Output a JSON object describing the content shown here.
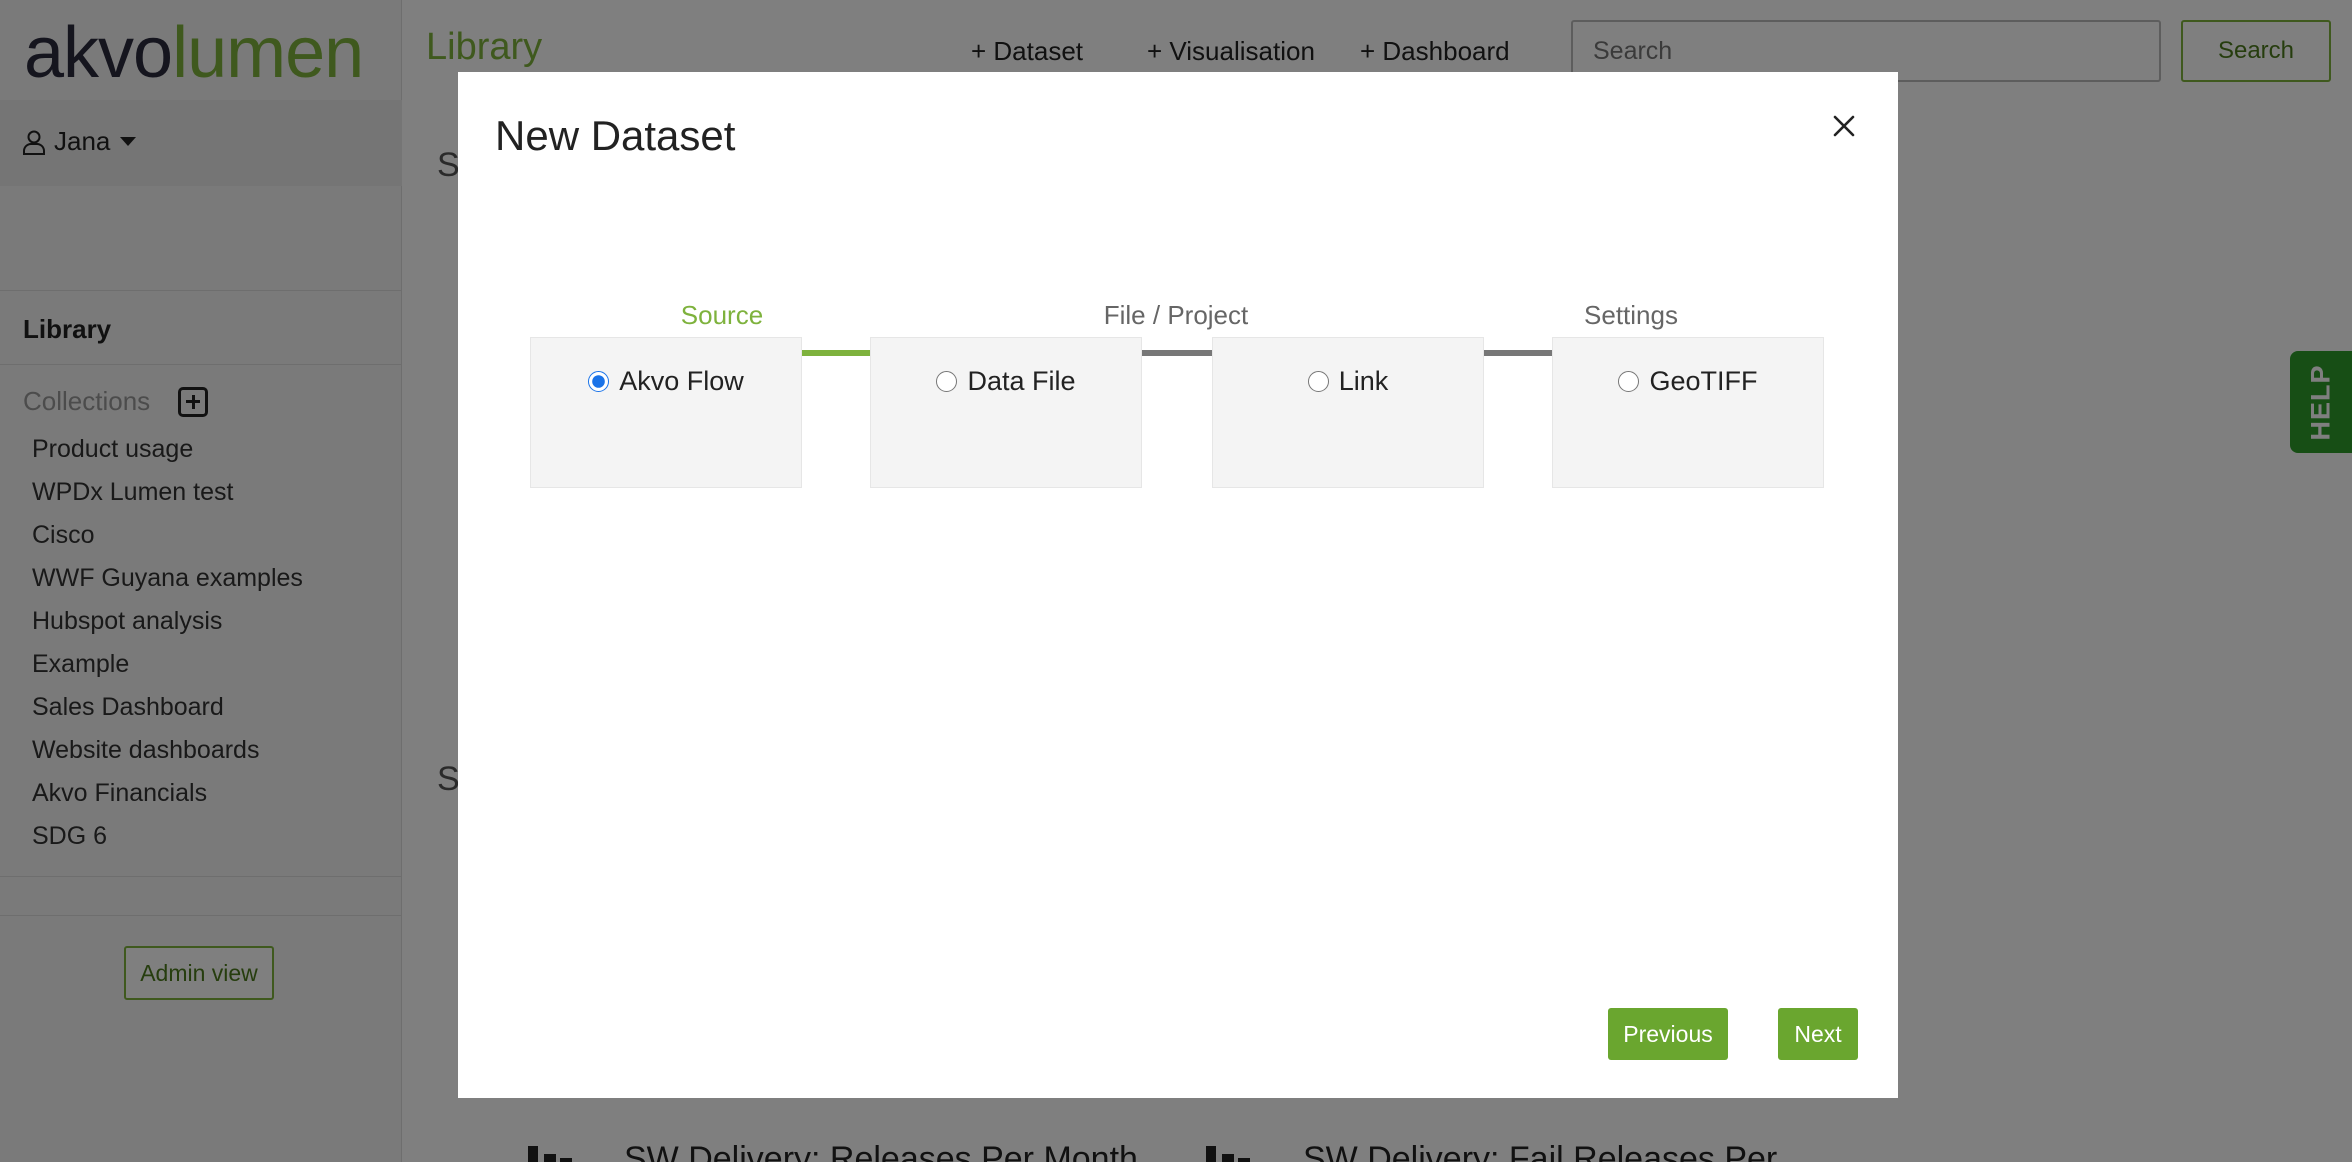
{
  "brand": {
    "logo_part1": "akvo",
    "logo_part2": "lumen"
  },
  "user": {
    "name": "Jana"
  },
  "sidebar": {
    "library_label": "Library",
    "collections_label": "Collections",
    "collections": [
      "Product usage",
      "WPDx Lumen test",
      "Cisco",
      "WWF Guyana examples",
      "Hubspot analysis",
      "Example",
      "Sales Dashboard",
      "Website dashboards",
      "Akvo Financials",
      "SDG 6"
    ],
    "admin_view": "Admin view"
  },
  "header": {
    "title": "Library",
    "create_dataset": "+ Dataset",
    "create_visualisation": "+ Visualisation",
    "create_dashboard": "+ Dashboard",
    "search_placeholder": "Search",
    "search_button": "Search"
  },
  "background": {
    "section_letter_1": "S",
    "section_letter_2": "S",
    "card_1": "SW Delivery: Releases Per Month",
    "card_2": "SW Delivery: Fail Releases Per"
  },
  "help": {
    "label": "HELP"
  },
  "modal": {
    "title": "New Dataset",
    "tabs": [
      {
        "label": "Source",
        "active": true
      },
      {
        "label": "File / Project",
        "active": false
      },
      {
        "label": "Settings",
        "active": false
      }
    ],
    "sources": [
      {
        "label": "Akvo Flow",
        "checked": true
      },
      {
        "label": "Data File",
        "checked": false
      },
      {
        "label": "Link",
        "checked": false
      },
      {
        "label": "GeoTIFF",
        "checked": false
      }
    ],
    "previous_button": "Previous",
    "next_button": "Next"
  },
  "colors": {
    "brand_green": "#7eb23d",
    "button_green": "#6aa62f",
    "help_green": "#2e9d2a",
    "logo_dark": "#2b2a3d"
  }
}
